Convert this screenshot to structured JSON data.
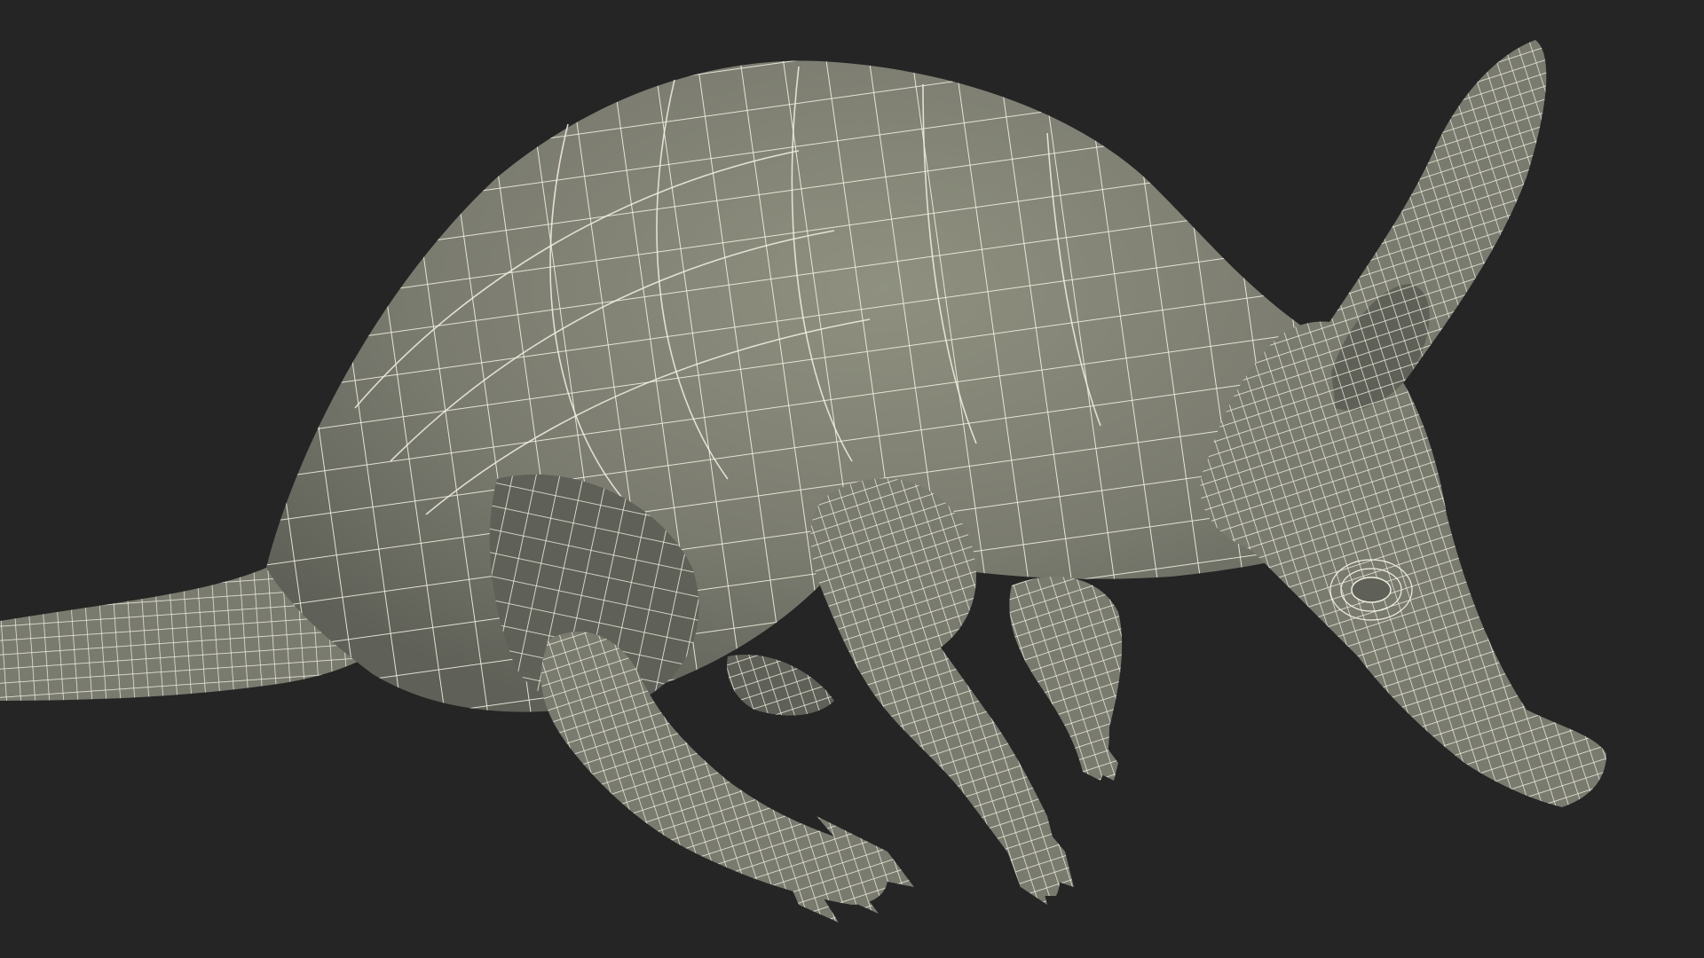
{
  "scene": {
    "subject": "aardvark-wireframe-model",
    "background_color": "#252525",
    "surface_color": "#7a7b6f",
    "shadow_color": "#5f6057",
    "highlight_color": "#8f907f",
    "wire_color": "#f2f0e2",
    "render_mode": "wireframe-on-shaded"
  }
}
